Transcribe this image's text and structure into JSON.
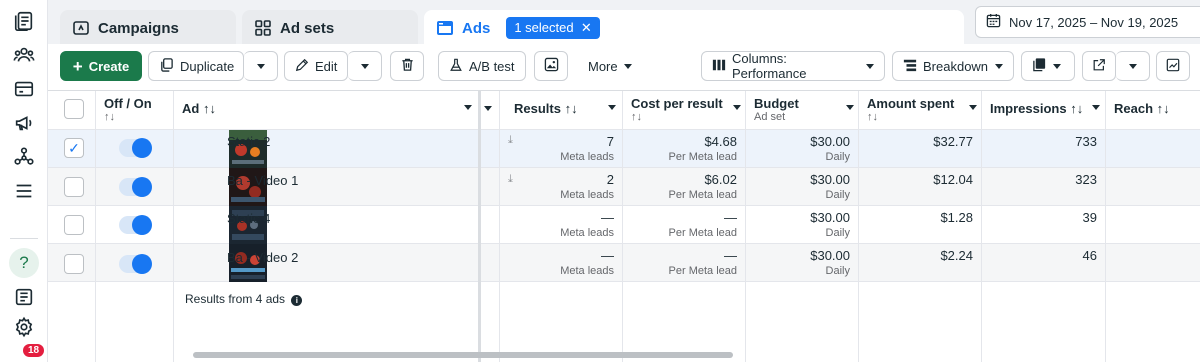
{
  "nav": {
    "badge": "18"
  },
  "tabs": [
    {
      "label": "Campaigns",
      "icon": "folder-icon"
    },
    {
      "label": "Ad sets",
      "icon": "grid-icon"
    },
    {
      "label": "Ads",
      "icon": "ad-icon"
    }
  ],
  "selected_pill": "1 selected",
  "date_range": "Nov 17, 2025 – Nov 19, 2025",
  "toolbar": {
    "create": "Create",
    "duplicate": "Duplicate",
    "edit": "Edit",
    "ab_test": "A/B test",
    "more": "More",
    "columns": "Columns: Performance",
    "breakdown": "Breakdown"
  },
  "columns": {
    "offon": "Off / On",
    "ad": "Ad",
    "results": "Results",
    "cost": "Cost per result",
    "budget": "Budget",
    "budget_sub": "Ad set",
    "amount": "Amount spent",
    "impressions": "Impressions",
    "reach": "Reach",
    "sort": "↑↓"
  },
  "rows": [
    {
      "name": "Static 2",
      "results": "7",
      "results_sub": "Meta leads",
      "cost": "$4.68",
      "cost_sub": "Per Meta lead",
      "budget": "$30.00",
      "budget_sub": "Daily",
      "amount": "$32.77",
      "impressions": "733",
      "selected": true
    },
    {
      "name": "Ba - Video 1",
      "results": "2",
      "results_sub": "Meta leads",
      "cost": "$6.02",
      "cost_sub": "Per Meta lead",
      "budget": "$30.00",
      "budget_sub": "Daily",
      "amount": "$12.04",
      "impressions": "323",
      "selected": false
    },
    {
      "name": "Static 4",
      "results": "—",
      "results_sub": "Meta leads",
      "cost": "—",
      "cost_sub": "Per Meta lead",
      "budget": "$30.00",
      "budget_sub": "Daily",
      "amount": "$1.28",
      "impressions": "39",
      "selected": false
    },
    {
      "name": "Ba - Video 2",
      "results": "—",
      "results_sub": "Meta leads",
      "cost": "—",
      "cost_sub": "Per Meta lead",
      "budget": "$30.00",
      "budget_sub": "Daily",
      "amount": "$2.24",
      "impressions": "46",
      "selected": false
    }
  ],
  "footer": "Results from 4 ads",
  "colors": {
    "accent": "#1877f2",
    "create": "#1b7a4b",
    "badge": "#e41e3f"
  }
}
